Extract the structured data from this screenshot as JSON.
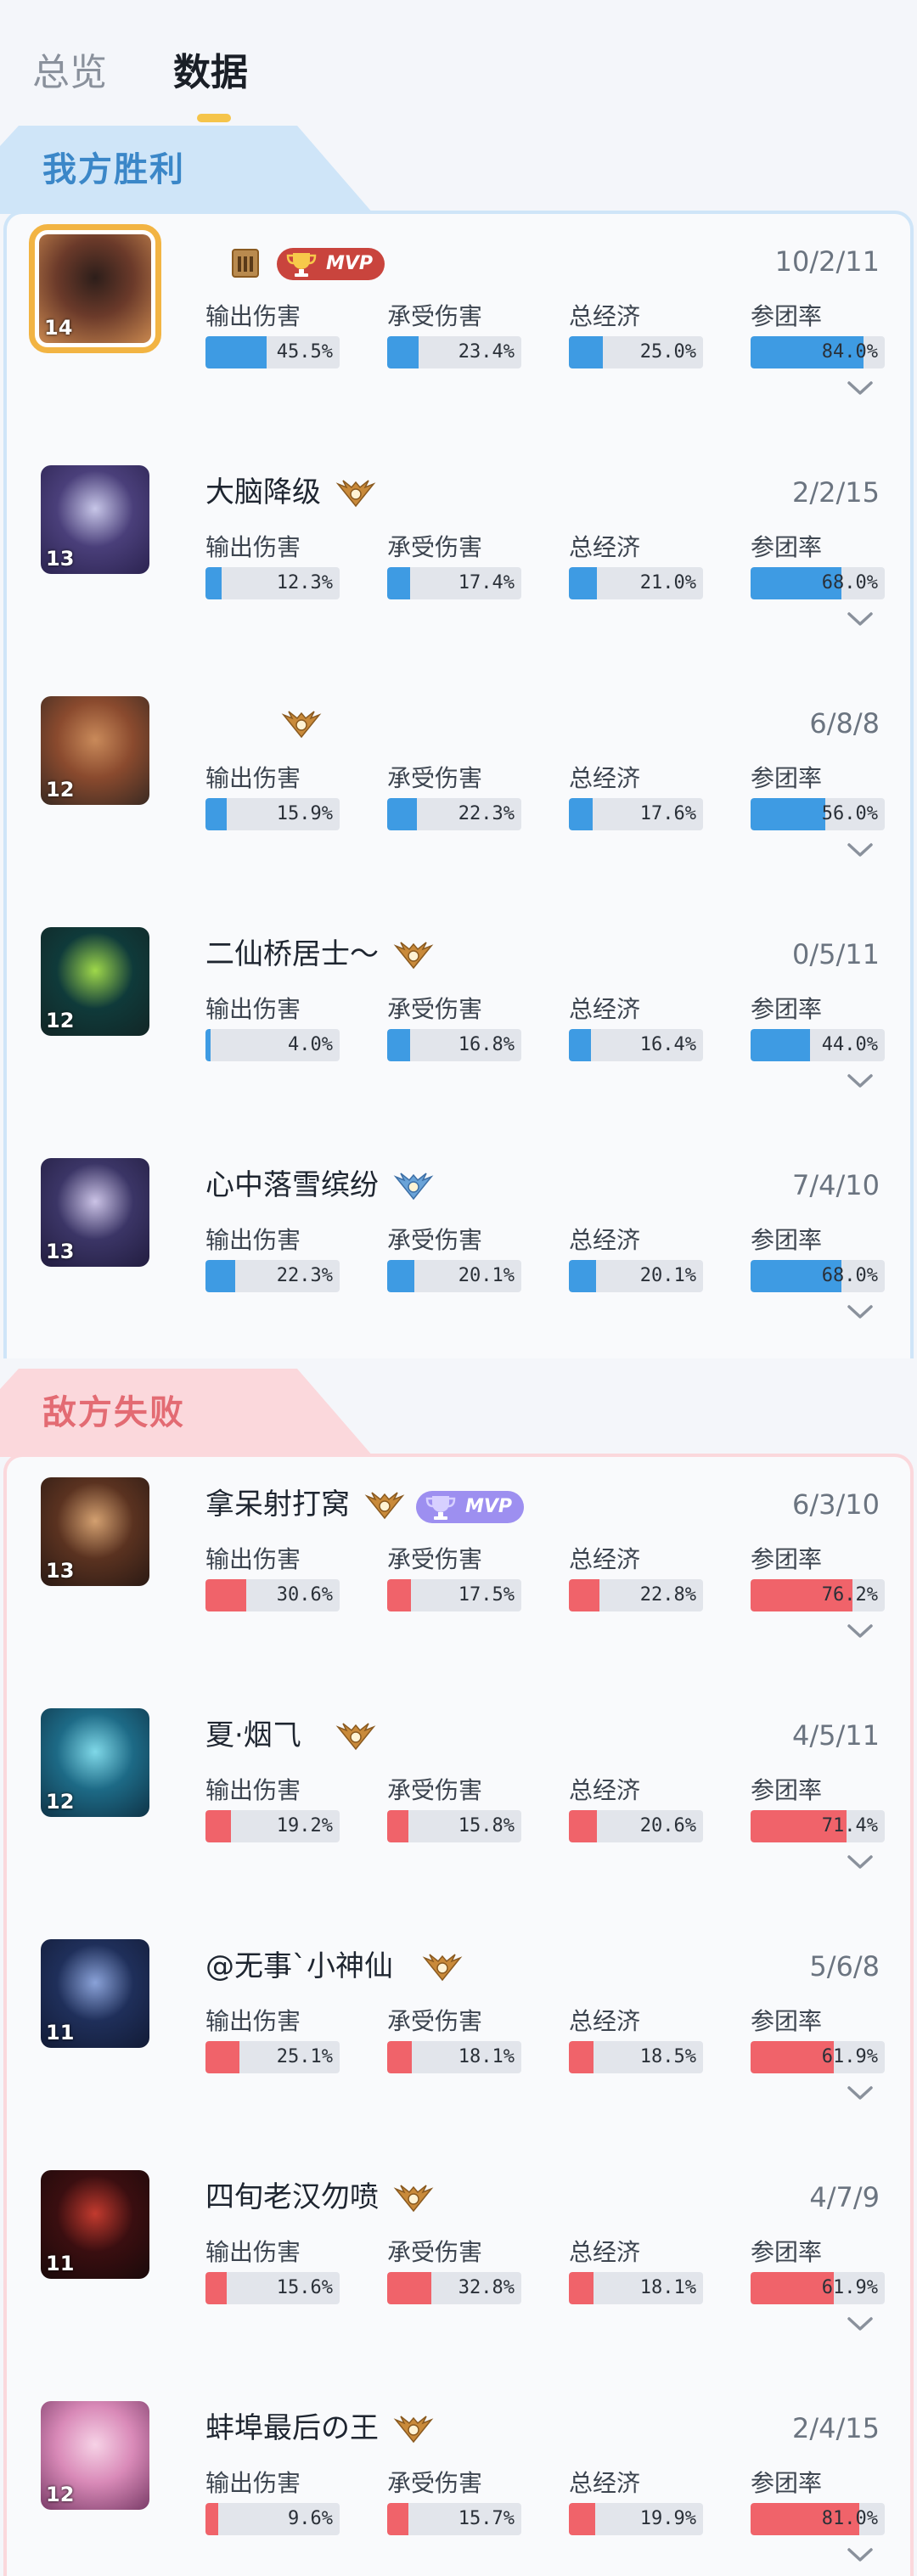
{
  "tabs": [
    {
      "label": "总览",
      "active": false
    },
    {
      "label": "数据",
      "active": true
    }
  ],
  "stat_labels": [
    "输出伤害",
    "承受伤害",
    "总经济",
    "参团率"
  ],
  "teams": [
    {
      "title": "我方胜利",
      "result": "win",
      "color": "#3e9be3",
      "players": [
        {
          "name": "",
          "level": "14",
          "kda": "10/2/11",
          "rank_icon": "rank-bronze-tier-icon",
          "mvp": "MVP",
          "mvp_style": "gold",
          "highlight": true,
          "stats": [
            "45.5%",
            "23.4%",
            "25.0%",
            "84.0%"
          ],
          "fills": [
            45.5,
            23.4,
            25.0,
            84.0
          ],
          "avatar_colors": [
            "#6b3a2a",
            "#2d1e1a",
            "#c9884f"
          ]
        },
        {
          "name": "大脑降级",
          "level": "13",
          "kda": "2/2/15",
          "rank_icon": "rank-gold-wings-icon",
          "mvp": "",
          "mvp_style": "",
          "stats": [
            "12.3%",
            "17.4%",
            "21.0%",
            "68.0%"
          ],
          "fills": [
            12.3,
            17.4,
            21.0,
            68.0
          ],
          "avatar_colors": [
            "#4a3f7a",
            "#c7c6e8",
            "#2b2350"
          ]
        },
        {
          "name": "",
          "level": "12",
          "kda": "6/8/8",
          "rank_icon": "rank-gold-wings-icon",
          "mvp": "",
          "mvp_style": "",
          "stats": [
            "15.9%",
            "22.3%",
            "17.6%",
            "56.0%"
          ],
          "fills": [
            15.9,
            22.3,
            17.6,
            56.0
          ],
          "avatar_colors": [
            "#8a4a2e",
            "#c98a5a",
            "#3a2a22"
          ]
        },
        {
          "name": "二仙桥居士～",
          "level": "12",
          "kda": "0/5/11",
          "rank_icon": "rank-gold-wings-icon",
          "mvp": "",
          "mvp_style": "",
          "stats": [
            "4.0%",
            "16.8%",
            "16.4%",
            "44.0%"
          ],
          "fills": [
            4.0,
            16.8,
            16.4,
            44.0
          ],
          "avatar_colors": [
            "#0f3a3a",
            "#9fd84a",
            "#122626"
          ]
        },
        {
          "name": "心中落雪缤纷",
          "level": "13",
          "kda": "7/4/10",
          "rank_icon": "rank-diamond-wings-icon",
          "mvp": "",
          "mvp_style": "",
          "stats": [
            "22.3%",
            "20.1%",
            "20.1%",
            "68.0%"
          ],
          "fills": [
            22.3,
            20.1,
            20.1,
            68.0
          ],
          "avatar_colors": [
            "#3b3566",
            "#cbc3e6",
            "#221d40"
          ]
        }
      ]
    },
    {
      "title": "敌方失败",
      "result": "lose",
      "color": "#f0636a",
      "players": [
        {
          "name": "拿呆射打窝",
          "level": "13",
          "kda": "6/3/10",
          "rank_icon": "rank-gold-wings-icon",
          "mvp": "MVP",
          "mvp_style": "purple",
          "stats": [
            "30.6%",
            "17.5%",
            "22.8%",
            "76.2%"
          ],
          "fills": [
            30.6,
            17.5,
            22.8,
            76.2
          ],
          "avatar_colors": [
            "#5a3220",
            "#d3a070",
            "#2b1a14"
          ]
        },
        {
          "name": "夏·烟⺄",
          "level": "12",
          "kda": "4/5/11",
          "rank_icon": "rank-gold-wings-icon",
          "mvp": "",
          "mvp_style": "",
          "stats": [
            "19.2%",
            "15.8%",
            "20.6%",
            "71.4%"
          ],
          "fills": [
            19.2,
            15.8,
            20.6,
            71.4
          ],
          "avatar_colors": [
            "#1d6a86",
            "#7fd8e8",
            "#0f3448"
          ]
        },
        {
          "name": "@无事`小神仙",
          "level": "11",
          "kda": "5/6/8",
          "rank_icon": "rank-gold-wings-icon",
          "mvp": "",
          "mvp_style": "",
          "stats": [
            "25.1%",
            "18.1%",
            "18.5%",
            "61.9%"
          ],
          "fills": [
            25.1,
            18.1,
            18.5,
            61.9
          ],
          "avatar_colors": [
            "#1f2f5a",
            "#8aa2d8",
            "#121b36"
          ]
        },
        {
          "name": "四旬老汉勿喷",
          "level": "11",
          "kda": "4/7/9",
          "rank_icon": "rank-gold-wings-icon",
          "mvp": "",
          "mvp_style": "",
          "stats": [
            "15.6%",
            "32.8%",
            "18.1%",
            "61.9%"
          ],
          "fills": [
            15.6,
            32.8,
            18.1,
            61.9
          ],
          "avatar_colors": [
            "#3a0e10",
            "#c23a2e",
            "#1a0a0a"
          ]
        },
        {
          "name": "蚌埠最后の王",
          "level": "12",
          "kda": "2/4/15",
          "rank_icon": "rank-gold-wings-icon",
          "mvp": "",
          "mvp_style": "",
          "stats": [
            "9.6%",
            "15.7%",
            "19.9%",
            "81.0%"
          ],
          "fills": [
            9.6,
            15.7,
            19.9,
            81.0
          ],
          "avatar_colors": [
            "#d98ab8",
            "#f6d2e6",
            "#7a3c68"
          ]
        }
      ]
    }
  ]
}
